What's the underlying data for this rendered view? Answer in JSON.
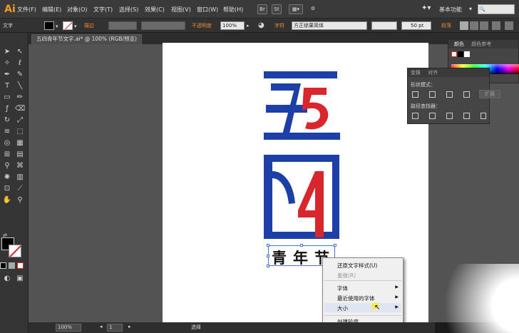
{
  "app": {
    "logo": "Ai"
  },
  "menu": [
    "文件(F)",
    "编辑(E)",
    "对象(O)",
    "文字(T)",
    "选择(S)",
    "效果(C)",
    "视图(V)",
    "窗口(W)",
    "帮助(H)"
  ],
  "menubar_buttons": [
    "Br",
    "St"
  ],
  "workspace": "基本功能",
  "search": {
    "value": ""
  },
  "control_bar": {
    "mode_label": "文字",
    "stroke_label": "描边",
    "opacity_label": "不透明度",
    "opacity_value": "100%",
    "char_label": "字符",
    "font_value": "方正综果简体",
    "size_value": "50 pt",
    "para_label": "段落"
  },
  "document_tab": {
    "title": "五四青年节文字.ai* @ 100% (RGB/预览)"
  },
  "artwork": {
    "title_text": "青年节",
    "colors": {
      "blue": "#1d3fa8",
      "red": "#d8262c"
    }
  },
  "color_panel": {
    "tabs": [
      "颜色",
      "颜色参考"
    ]
  },
  "pathfinder_panel": {
    "tabs": [
      "变换",
      "对齐"
    ],
    "shape_modes_label": "形状模式：",
    "expand_label": "扩展",
    "pathfinder_label": "路径查找器："
  },
  "context_menu": {
    "items": [
      {
        "label": "还原文字样式(U)",
        "enabled": true
      },
      {
        "label": "重做(R)",
        "enabled": false
      },
      {
        "label": "字体",
        "submenu": true
      },
      {
        "label": "最近使用的字体",
        "submenu": true
      },
      {
        "label": "大小",
        "submenu": true
      },
      {
        "label": "创建轮廓",
        "enabled": true
      }
    ]
  },
  "status_bar": {
    "zoom": "100%",
    "page": "1",
    "tool": "选择"
  }
}
